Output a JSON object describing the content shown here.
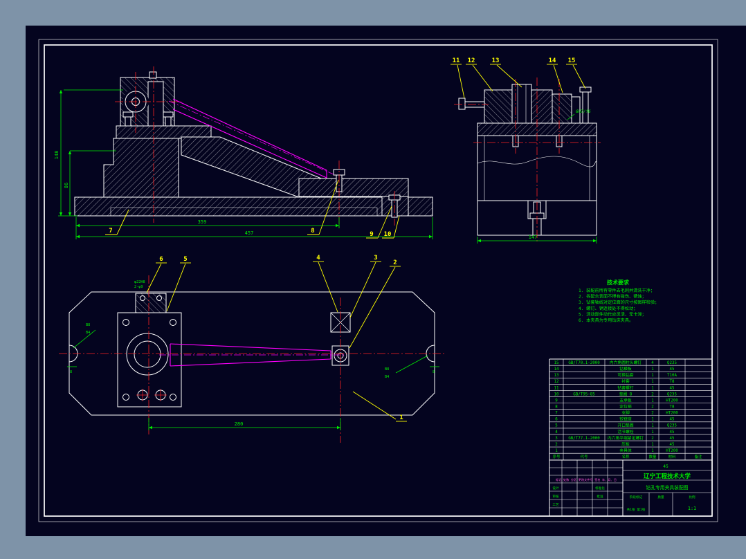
{
  "drawing": {
    "dims": {
      "side_height": "148",
      "side_step": "86",
      "side_mid": "359",
      "side_total": "457",
      "section_width": "147",
      "plan_span": "280",
      "plan_notch_left": "8",
      "plan_notch_right": "8"
    },
    "labels": {
      "fit": "6H7/f6",
      "datum_top": "B8",
      "datum_bottom": "B4",
      "clamp_hole": "φ22H8",
      "clamp_pins": "2-φ9"
    },
    "callouts": {
      "c1": "1",
      "c2": "2",
      "c3": "3",
      "c4": "4",
      "c5": "5",
      "c6": "6",
      "c7": "7",
      "c8": "8",
      "c9": "9",
      "c10": "10",
      "c11": "11",
      "c12": "12",
      "c13": "13",
      "c14": "14",
      "c15": "15"
    }
  },
  "notes": {
    "title": "技术要求",
    "lines": [
      "1. 装配前所有零件去毛刺并清洗干净；",
      "2. 各配合表面不得有碰伤、锈蚀；",
      "3. 钻套轴线对定位面的尺寸按图样检验；",
      "4. 螺钉、销连接处不得松动；",
      "5. 活动部件动作应灵活、无卡滞；",
      "6. 本夹具为专用钻床夹具。"
    ]
  },
  "bom": {
    "header": {
      "no": "序号",
      "code": "代号",
      "name": "名称",
      "qty": "数量",
      "material": "材料",
      "note": "备注"
    },
    "rows": [
      {
        "no": "15",
        "code": "GB/T70.1-2000",
        "name": "内六角圆柱头螺钉",
        "qty": "4",
        "material": "Q235",
        "note": ""
      },
      {
        "no": "14",
        "code": "",
        "name": "钻模板",
        "qty": "1",
        "material": "45",
        "note": ""
      },
      {
        "no": "13",
        "code": "",
        "name": "可换钻套",
        "qty": "1",
        "material": "T10A",
        "note": ""
      },
      {
        "no": "12",
        "code": "",
        "name": "衬套",
        "qty": "1",
        "material": "T8",
        "note": ""
      },
      {
        "no": "11",
        "code": "",
        "name": "钻套螺钉",
        "qty": "1",
        "material": "45",
        "note": ""
      },
      {
        "no": "10",
        "code": "GB/T95-85",
        "name": "垫圈 8",
        "qty": "2",
        "material": "Q235",
        "note": ""
      },
      {
        "no": "9",
        "code": "",
        "name": "支承板",
        "qty": "1",
        "material": "HT200",
        "note": ""
      },
      {
        "no": "8",
        "code": "",
        "name": "定位销",
        "qty": "2",
        "material": "T8",
        "note": ""
      },
      {
        "no": "7",
        "code": "",
        "name": "支脚",
        "qty": "2",
        "material": "HT200",
        "note": ""
      },
      {
        "no": "6",
        "code": "",
        "name": "铰链座",
        "qty": "1",
        "material": "45",
        "note": ""
      },
      {
        "no": "5",
        "code": "",
        "name": "开口垫圈",
        "qty": "1",
        "material": "Q235",
        "note": ""
      },
      {
        "no": "4",
        "code": "",
        "name": "活节螺栓",
        "qty": "1",
        "material": "45",
        "note": ""
      },
      {
        "no": "3",
        "code": "GB/T77.1-2000",
        "name": "内六角平端紧定螺钉",
        "qty": "2",
        "material": "45",
        "note": ""
      },
      {
        "no": "2",
        "code": "",
        "name": "压板",
        "qty": "1",
        "material": "45",
        "note": ""
      },
      {
        "no": "1",
        "code": "",
        "name": "夹具体",
        "qty": "1",
        "material": "HT200",
        "note": ""
      }
    ]
  },
  "titleblock": {
    "school": "辽宁工程技术大学",
    "title": "钻孔专用夹具装配图",
    "material": "45",
    "rev_header": "标记 处数 分区 更改文件号 签名 年、月、日",
    "design": "设计",
    "check": "审核",
    "process": "工艺",
    "standard": "标准化",
    "approve": "批准",
    "stage_label": "阶段标记",
    "mass_label": "质量",
    "scale_label": "比例",
    "scale": "1:1",
    "sheet": "共1张 第1张"
  }
}
